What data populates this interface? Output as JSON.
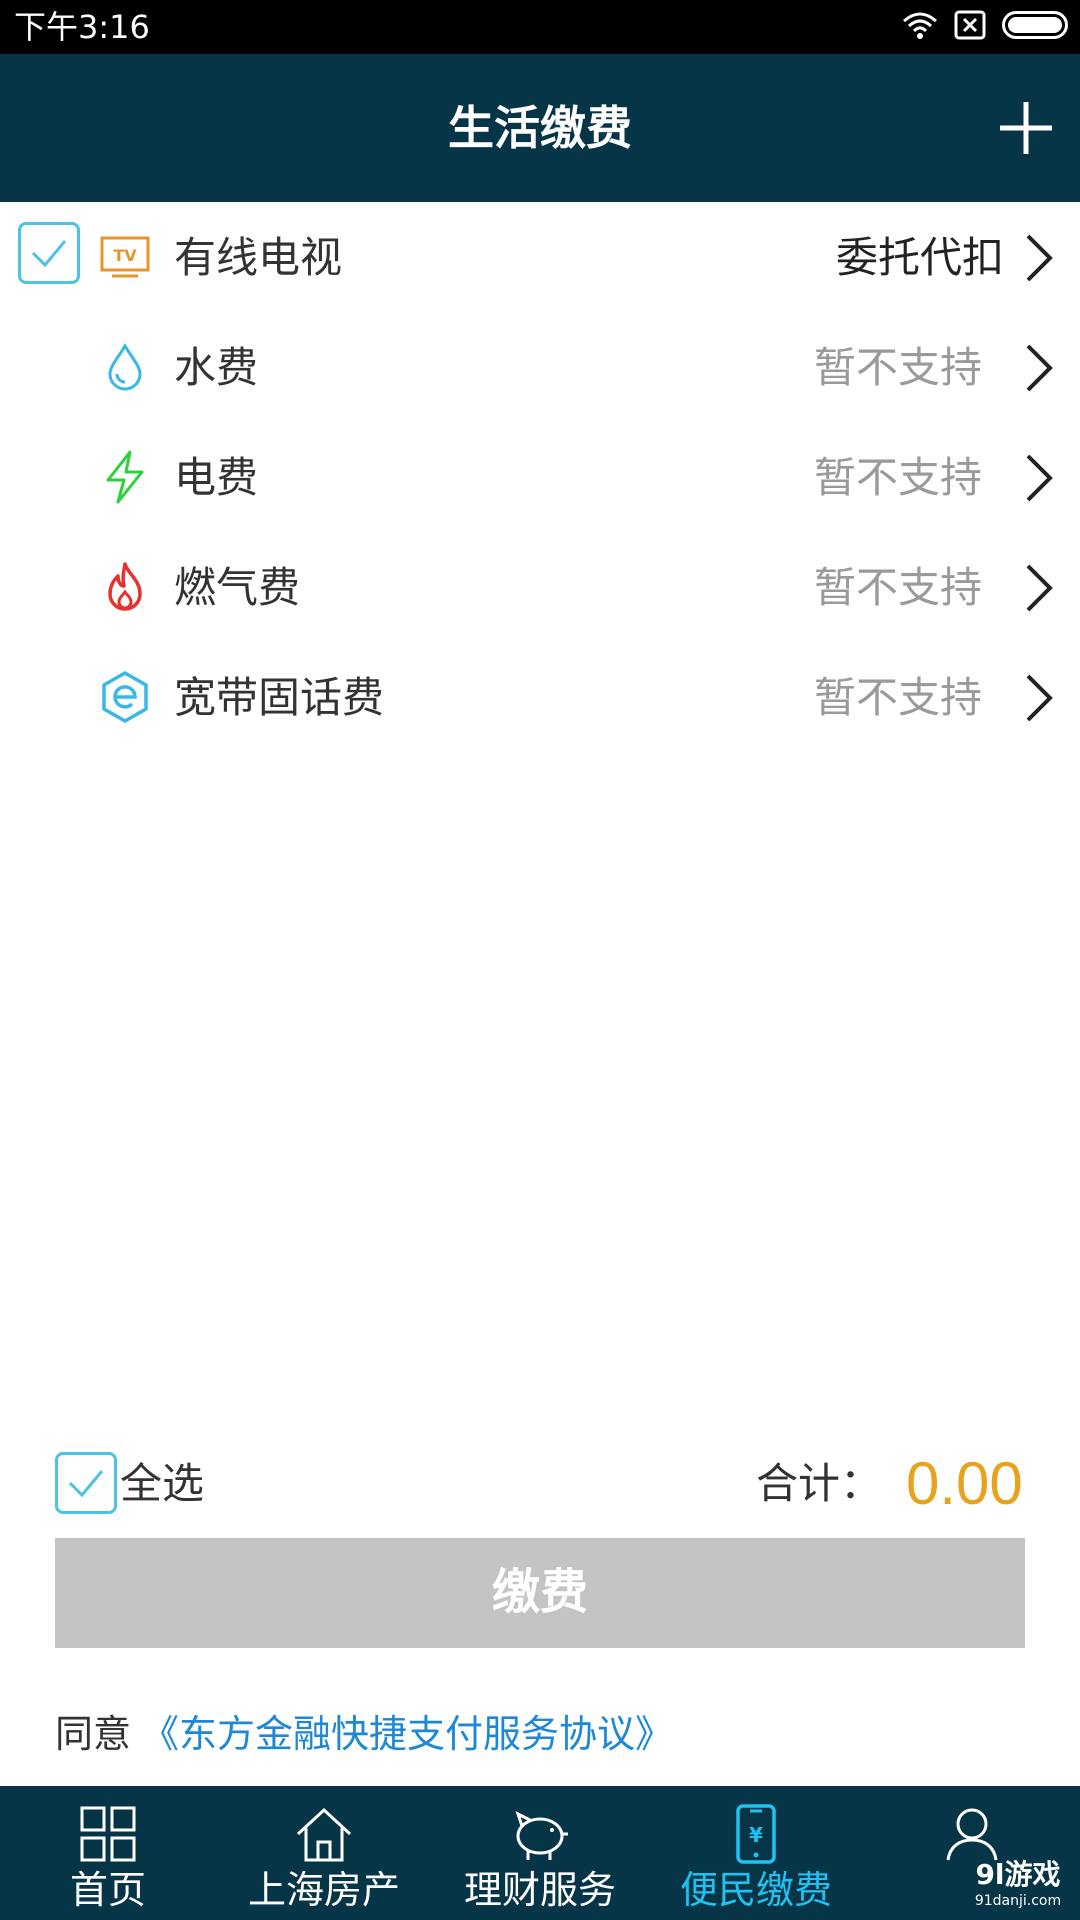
{
  "status_bar": {
    "time": "下午3:16"
  },
  "header": {
    "title": "生活缴费"
  },
  "bills": [
    {
      "label": "有线电视",
      "status": "委托代扣",
      "icon": "tv-icon",
      "checked": true
    },
    {
      "label": "水费",
      "status": "暂不支持",
      "icon": "water-drop-icon",
      "checked": false
    },
    {
      "label": "电费",
      "status": "暂不支持",
      "icon": "lightning-icon",
      "checked": false
    },
    {
      "label": "燃气费",
      "status": "暂不支持",
      "icon": "flame-icon",
      "checked": false
    },
    {
      "label": "宽带固话费",
      "status": "暂不支持",
      "icon": "broadband-icon",
      "checked": false
    }
  ],
  "footer": {
    "select_all_label": "全选",
    "total_label": "合计：",
    "total_value": "0.00",
    "pay_button": "缴费",
    "agree_text": "同意",
    "agreement_link": "《东方金融快捷支付服务协议》"
  },
  "nav": [
    {
      "label": "首页",
      "icon": "grid-icon"
    },
    {
      "label": "上海房产",
      "icon": "home-icon"
    },
    {
      "label": "理财服务",
      "icon": "piggy-bank-icon"
    },
    {
      "label": "便民缴费",
      "icon": "phone-yuan-icon",
      "active": true
    },
    {
      "label": "",
      "icon": "user-icon"
    }
  ],
  "watermark": {
    "logo": "9l游戏",
    "site": "91danji.com"
  },
  "colors": {
    "header_bg": "#073548",
    "accent_blue": "#1fc1ef",
    "checkbox": "#4cc3e6",
    "total_amount": "#e8a21c",
    "link": "#1f88d6",
    "disabled_button": "#c4c4c4"
  }
}
